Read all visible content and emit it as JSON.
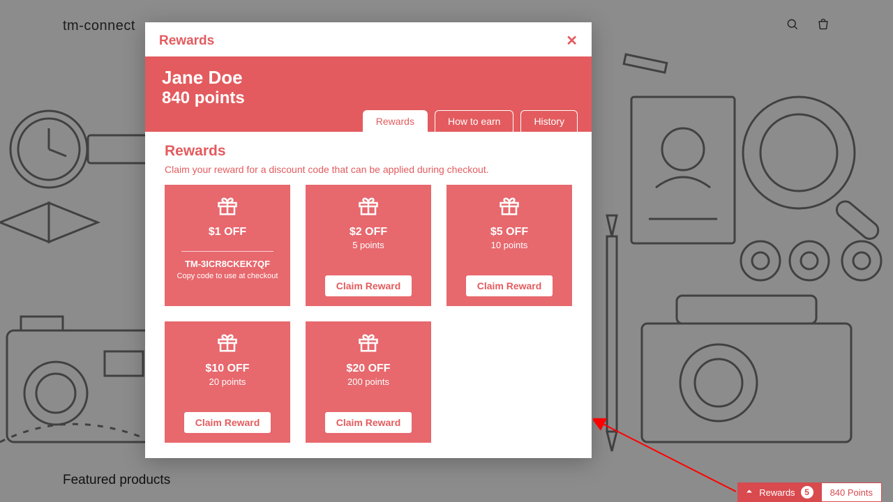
{
  "brand": "tm-connect",
  "featured_heading": "Featured products",
  "widget": {
    "label": "Rewards",
    "badge": "5",
    "points": "840 Points"
  },
  "modal": {
    "title": "Rewards",
    "user_name": "Jane Doe",
    "user_points": "840 points",
    "tabs": {
      "rewards": "Rewards",
      "earn": "How to earn",
      "history": "History"
    },
    "section_title": "Rewards",
    "section_sub": "Claim your reward for a discount code that can be applied during checkout.",
    "claim_label": "Claim Reward",
    "code_hint": "Copy code to use at checkout",
    "cards": [
      {
        "title": "$1 OFF",
        "cost": "",
        "code": "TM-3ICR8CKEK7QF"
      },
      {
        "title": "$2 OFF",
        "cost": "5 points",
        "code": ""
      },
      {
        "title": "$5 OFF",
        "cost": "10 points",
        "code": ""
      },
      {
        "title": "$10 OFF",
        "cost": "20 points",
        "code": ""
      },
      {
        "title": "$20 OFF",
        "cost": "200 points",
        "code": ""
      }
    ]
  }
}
